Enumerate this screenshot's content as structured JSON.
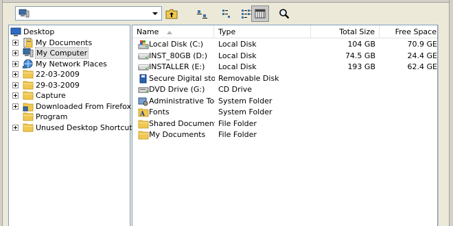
{
  "address": {
    "value": ""
  },
  "toolbar": {
    "buttons": [
      {
        "name": "up-folder-button",
        "icon": "up-folder-icon"
      },
      {
        "name": "view-large-icons-button",
        "icon": "large-icons-icon"
      },
      {
        "name": "view-small-icons-button",
        "icon": "small-icons-icon"
      },
      {
        "name": "view-list-button",
        "icon": "list-icon"
      },
      {
        "name": "view-details-button",
        "icon": "details-icon",
        "active": true
      },
      {
        "name": "search-button",
        "icon": "search-icon"
      }
    ]
  },
  "tree": {
    "items": [
      {
        "label": "Desktop",
        "icon": "desktop-icon",
        "expander": false,
        "indent": 0
      },
      {
        "label": "My Documents",
        "icon": "my-documents-icon",
        "expander": true,
        "indent": 1
      },
      {
        "label": "My Computer",
        "icon": "my-computer-icon",
        "expander": true,
        "indent": 1,
        "selected": true
      },
      {
        "label": "My Network Places",
        "icon": "network-icon",
        "expander": true,
        "indent": 1
      },
      {
        "label": "22-03-2009",
        "icon": "folder-icon",
        "expander": true,
        "indent": 1
      },
      {
        "label": "29-03-2009",
        "icon": "folder-icon",
        "expander": true,
        "indent": 1
      },
      {
        "label": "Capture",
        "icon": "folder-icon",
        "expander": true,
        "indent": 1
      },
      {
        "label": "Downloaded From Firefox",
        "icon": "folder-special-icon",
        "expander": true,
        "indent": 1
      },
      {
        "label": "Program",
        "icon": "folder-icon",
        "expander": false,
        "indent": 1
      },
      {
        "label": "Unused Desktop Shortcuts",
        "icon": "folder-icon",
        "expander": true,
        "indent": 1
      }
    ]
  },
  "list": {
    "columns": {
      "name": "Name",
      "type": "Type",
      "total_size": "Total Size",
      "free_space": "Free Space"
    },
    "rows": [
      {
        "name": "Local Disk (C:)",
        "type": "Local Disk",
        "total": "104 GB",
        "free": "70.9 GE",
        "icon": "local-disk-c-icon"
      },
      {
        "name": "INST_80GB (D:)",
        "type": "Local Disk",
        "total": "74.5 GB",
        "free": "24.4 GE",
        "icon": "hard-drive-icon"
      },
      {
        "name": "INSTALLER (E:)",
        "type": "Local Disk",
        "total": "193 GB",
        "free": "62.4 GE",
        "icon": "hard-drive-icon"
      },
      {
        "name": "Secure Digital sto...",
        "type": "Removable Disk",
        "total": "",
        "free": "",
        "icon": "removable-disk-icon"
      },
      {
        "name": "DVD Drive (G:)",
        "type": "CD Drive",
        "total": "",
        "free": "",
        "icon": "dvd-drive-icon"
      },
      {
        "name": "Administrative Tools",
        "type": "System Folder",
        "total": "",
        "free": "",
        "icon": "admin-tools-icon"
      },
      {
        "name": "Fonts",
        "type": "System Folder",
        "total": "",
        "free": "",
        "icon": "fonts-folder-icon"
      },
      {
        "name": "Shared Documents",
        "type": "File Folder",
        "total": "",
        "free": "",
        "icon": "folder-icon"
      },
      {
        "name": "My Documents",
        "type": "File Folder",
        "total": "",
        "free": "",
        "icon": "folder-icon"
      }
    ]
  },
  "colors": {
    "folder": "#f0c850",
    "folder_dark": "#c9a030",
    "pane_border": "#7f9db9",
    "selected_bg": "#e3e3e3"
  }
}
